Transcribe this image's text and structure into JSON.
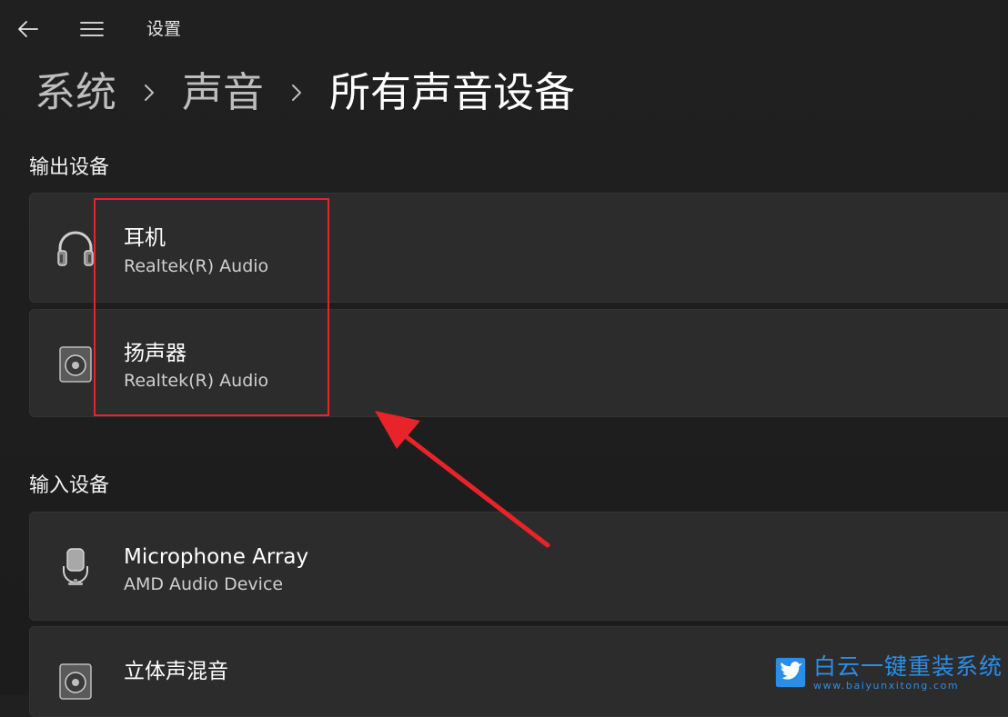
{
  "window": {
    "title": "设置"
  },
  "breadcrumb": {
    "items": [
      "系统",
      "声音",
      "所有声音设备"
    ]
  },
  "sections": {
    "output": {
      "title": "输出设备",
      "devices": [
        {
          "name": "耳机",
          "subtitle": "Realtek(R) Audio",
          "icon": "headphones-icon"
        },
        {
          "name": "扬声器",
          "subtitle": "Realtek(R) Audio",
          "icon": "speaker-icon"
        }
      ]
    },
    "input": {
      "title": "输入设备",
      "devices": [
        {
          "name": "Microphone Array",
          "subtitle": "AMD Audio Device",
          "icon": "microphone-icon"
        },
        {
          "name": "立体声混音",
          "subtitle": "",
          "icon": "speaker-icon"
        }
      ]
    }
  },
  "annotations": {
    "highlight_color": "#e8232a",
    "arrow_color": "#e8232a"
  },
  "watermark": {
    "name": "白云一键重装系统",
    "url": "www.baiyunxitong.com",
    "color": "#2a8ee8"
  },
  "colors": {
    "background": "#1f1f1f",
    "card": "#2c2c2c"
  }
}
